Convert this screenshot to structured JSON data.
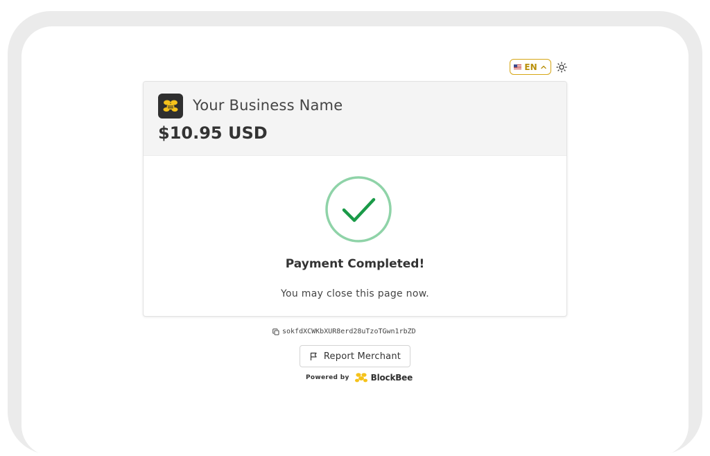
{
  "language": {
    "code": "EN",
    "flag_icon": "us-flag-icon"
  },
  "theme_toggle": {
    "icon": "sun-icon"
  },
  "merchant": {
    "name": "Your Business Name",
    "logo_icon": "bee-logo-icon"
  },
  "payment": {
    "amount": "$10.95 USD"
  },
  "status": {
    "icon": "checkmark-circle-icon",
    "title": "Payment Completed!",
    "message": "You may close this page now."
  },
  "transaction": {
    "id": "sokfdXCWKbXUR8erd28uTzoTGwn1rbZD",
    "copy_icon": "copy-icon"
  },
  "report": {
    "label": "Report Merchant",
    "icon": "flag-icon"
  },
  "footer": {
    "powered_by": "Powered by",
    "brand": "BlockBee"
  },
  "colors": {
    "accent": "#d6a614",
    "success": "#1a9a48",
    "success_ring": "#8fd3a8",
    "header_bg": "#f4f4f4",
    "frame": "#ebebeb"
  }
}
